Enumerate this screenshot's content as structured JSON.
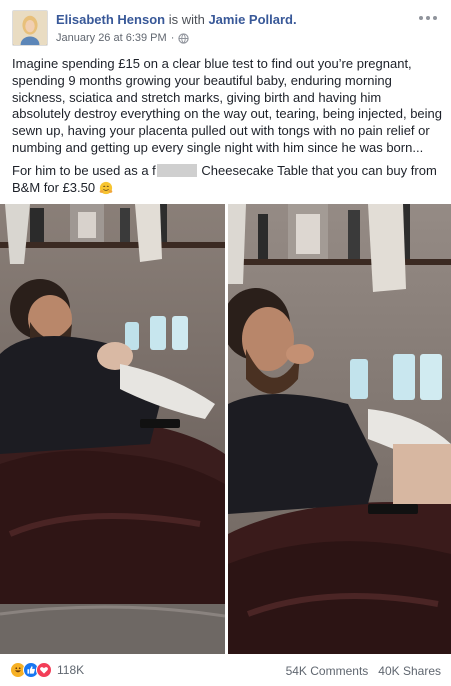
{
  "post": {
    "author": "Elisabeth Henson",
    "with_text": "is with",
    "tagged": "Jamie Pollard.",
    "timestamp": "January 26 at 6:39 PM",
    "separator": "·",
    "audience_icon": "globe-icon",
    "more_icon": "more-options-icon",
    "paragraph1": "Imagine spending £15 on a clear blue test to find out you’re pregnant, spending 9 months growing your beautiful baby, enduring morning sickness, sciatica and stretch marks, giving birth and having him absolutely destroy everything on the way out, tearing, being injected, being sewn up, having your placenta pulled out with tongs with no pain relief or numbing and getting up every single night with him since he was born...",
    "paragraph2_start": "For him to be used as a f",
    "paragraph2_end": "Cheesecake Table that you can buy from B&M for £3.50",
    "paragraph2_emoji": "hugging-face-emoji"
  },
  "photos": [
    {
      "name": "photo-left",
      "description_icon": "photo"
    },
    {
      "name": "photo-right",
      "description_icon": "photo"
    }
  ],
  "footer": {
    "reaction_icons": [
      "haha-icon",
      "like-icon",
      "love-icon"
    ],
    "reaction_count": "118K",
    "comments": "54K Comments",
    "shares": "40K Shares"
  },
  "colors": {
    "link": "#385898",
    "text": "#1d2129",
    "meta": "#616770",
    "like": "#1877f2",
    "love": "#f33e58",
    "haha": "#f7b125"
  }
}
